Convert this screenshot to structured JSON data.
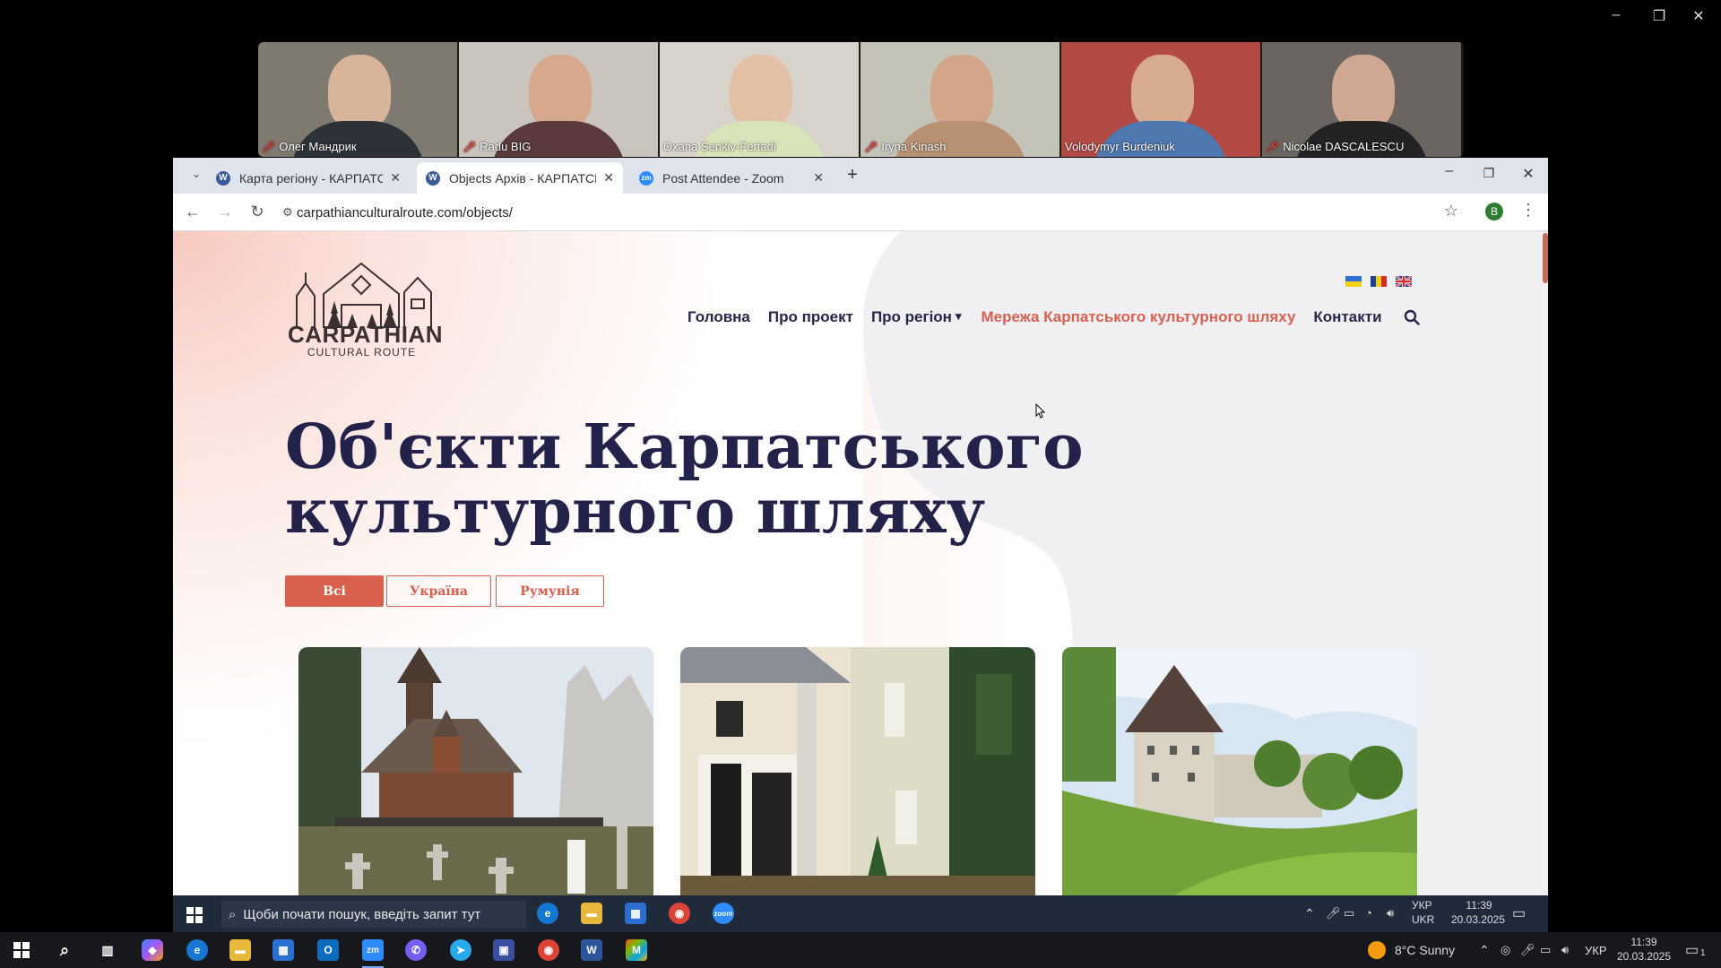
{
  "zoom_window": {
    "controls": [
      "–",
      "❐",
      "✕"
    ]
  },
  "participants": [
    {
      "name": "Олег Мандрик",
      "muted": true,
      "bg": "#7f7a70",
      "skin": "#d8b49a",
      "shirt": "#2d3138",
      "active": false
    },
    {
      "name": "Radu BIG",
      "muted": true,
      "bg": "#c9c4bd",
      "skin": "#d6a98c",
      "shirt": "#5a3a3a",
      "active": false
    },
    {
      "name": "Oxana Senkiv-Fertadi",
      "muted": false,
      "bg": "#d8d3ca",
      "skin": "#e3c1a6",
      "shirt": "#d8e3b8",
      "active": false
    },
    {
      "name": "Iryna Kinash",
      "muted": true,
      "bg": "#c3c3b8",
      "skin": "#d3a68a",
      "shirt": "#b89072",
      "active": false
    },
    {
      "name": "Volodymyr Burdeniuk",
      "muted": false,
      "bg": "#b24a43",
      "skin": "#d7ab90",
      "shirt": "#4d78b0",
      "active": true
    },
    {
      "name": "Nicolae DASCALESCU",
      "muted": true,
      "bg": "#6a6560",
      "skin": "#d0a891",
      "shirt": "#232326",
      "active": false
    }
  ],
  "browser": {
    "tabs": [
      {
        "title": "Карта регіону - КАРПАТСЬКИЙ",
        "favicon": "W",
        "favicon_color": "#3a5a99",
        "active": false
      },
      {
        "title": "Objects Архів - КАРПАТСЬКИЙ",
        "favicon": "W",
        "favicon_color": "#3a5a99",
        "active": true
      },
      {
        "title": "Post Attendee - Zoom",
        "favicon": "zm",
        "favicon_color": "#2d8cff",
        "active": false
      }
    ],
    "new_tab": "+",
    "url": "carpathianculturalroute.com/objects/",
    "profile_initial": "B"
  },
  "site": {
    "logo_line1": "CARPATHIAN",
    "logo_line2": "CULTURAL ROUTE",
    "nav": {
      "home": "Головна",
      "about_project": "Про проект",
      "about_region": "Про регіон",
      "network": "Мережа Карпатського культурного шляху",
      "contacts": "Контакти"
    },
    "title": "Об'єкти Карпатського культурного шляху",
    "filters": {
      "all": "Всі",
      "ukraine": "Україна",
      "romania": "Румунія"
    },
    "accent": "#d9604f",
    "title_color": "#23224a"
  },
  "inner_taskbar": {
    "search_placeholder": "Щоби почати пошук, введіть запит тут",
    "lang_top": "УКР",
    "lang_bottom": "UKR",
    "time": "11:39",
    "date": "20.03.2025"
  },
  "os_taskbar": {
    "weather": "8°C  Sunny",
    "lang": "УКР",
    "time": "11:39",
    "date": "20.03.2025",
    "notif_count": "1"
  }
}
